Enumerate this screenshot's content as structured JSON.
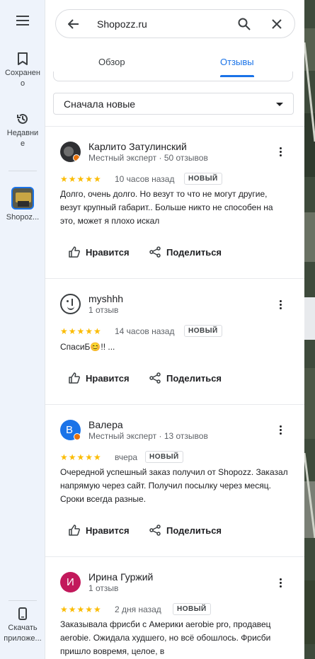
{
  "rail": {
    "saved_label": "Сохранено",
    "recent_label": "Недавние",
    "place_label": "Shopoz...",
    "download_label": "Скачать приложе..."
  },
  "search": {
    "value": "Shopozz.ru"
  },
  "tabs": {
    "overview": "Обзор",
    "reviews": "Отзывы"
  },
  "sort": {
    "label": "Сначала новые"
  },
  "reviews": [
    {
      "name": "Карлито Затулинский",
      "meta": "Местный эксперт · 50 отзывов",
      "stars": "★★★★★",
      "time": "10 часов назад",
      "badge": "НОВЫЙ",
      "text": "Долго, очень долго. Но везут то что не могут другие, везут крупный габарит.. Больше никто не способен на это, может я плохо искал",
      "like": "Нравится",
      "share": "Поделиться"
    },
    {
      "name": "myshhh",
      "meta": "1 отзыв",
      "stars": "★★★★★",
      "time": "14 часов назад",
      "badge": "НОВЫЙ",
      "text": "СпасиБ😊!! ...",
      "like": "Нравится",
      "share": "Поделиться"
    },
    {
      "name": "Валера",
      "avatar_letter": "В",
      "meta": "Местный эксперт · 13 отзывов",
      "stars": "★★★★★",
      "time": "вчера",
      "badge": "НОВЫЙ",
      "text": "Очередной успешный заказ получил от Shopozz. Заказал напрямую через сайт. Получил посылку через месяц. Сроки всегда разные.",
      "like": "Нравится",
      "share": "Поделиться"
    },
    {
      "name": "Ирина Гуржий",
      "avatar_letter": "И",
      "meta": "1 отзыв",
      "stars": "★★★★★",
      "time": "2 дня назад",
      "badge": "НОВЫЙ",
      "text": "Заказывала фрисби с Америки aerobie pro, продавец aerobie. Ожидала худшего, но всё обошлось. Фрисби пришло вовремя, целое, в"
    }
  ],
  "colors": {
    "accent": "#1a73e8",
    "star": "#fbbc04",
    "avatar_b": "#1a73e8",
    "avatar_i": "#c2185b"
  }
}
